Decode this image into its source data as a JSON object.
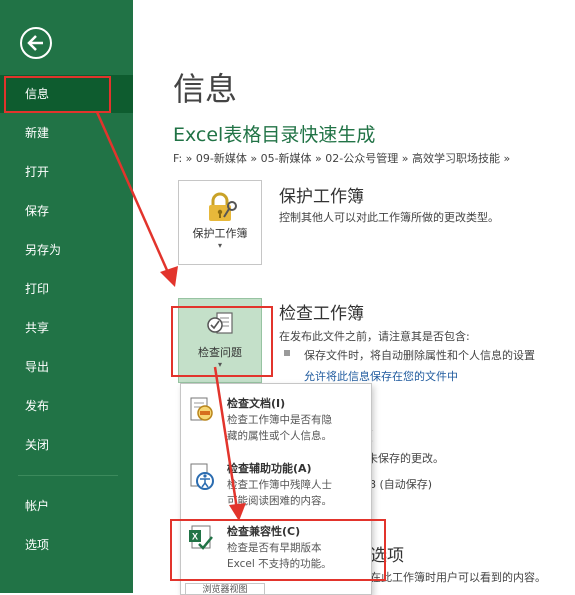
{
  "sidebar": {
    "items": [
      {
        "label": "信息"
      },
      {
        "label": "新建"
      },
      {
        "label": "打开"
      },
      {
        "label": "保存"
      },
      {
        "label": "另存为"
      },
      {
        "label": "打印"
      },
      {
        "label": "共享"
      },
      {
        "label": "导出"
      },
      {
        "label": "发布"
      },
      {
        "label": "关闭"
      },
      {
        "label": "帐户"
      },
      {
        "label": "选项"
      }
    ],
    "active_index": 0
  },
  "main": {
    "page_title": "信息",
    "workbook_title": "Excel表格目录快速生成",
    "breadcrumb": "F: » 09-新媒体 » 05-新媒体 » 02-公众号管理 » 高效学习职场技能 »",
    "protect": {
      "button_label": "保护工作簿",
      "title": "保护工作簿",
      "desc": "控制其他人可以对此工作簿所做的更改类型。"
    },
    "inspect": {
      "button_label": "检查问题",
      "title": "检查工作簿",
      "desc": "在发布此文件之前，请注意其是否包含:",
      "bullet": "保存文件时，将自动删除属性和个人信息的设置",
      "link": "允许将此信息保存在您的文件中"
    },
    "behind": {
      "title_fragment": "簿",
      "desc_fragment": "存未保存的更改。",
      "autosave_fragment": "8 (自动保存)",
      "options_fragment": "选项",
      "options_desc_fragment": "在此工作簿时用户可以看到的内容。",
      "view_button_fragment": "浏览器视图"
    }
  },
  "menu": {
    "items": [
      {
        "title": "检查文档(I)",
        "desc_line1": "检查工作簿中是否有隐",
        "desc_line2": "藏的属性或个人信息。",
        "icon": "inspect-document-icon"
      },
      {
        "title": "检查辅助功能(A)",
        "desc_line1": "检查工作簿中残障人士",
        "desc_line2": "可能阅读困难的内容。",
        "icon": "accessibility-icon"
      },
      {
        "title": "检查兼容性(C)",
        "desc_line1": "检查是否有早期版本",
        "desc_line2": "Excel 不支持的功能。",
        "icon": "compatibility-icon"
      }
    ]
  },
  "colors": {
    "sidebar": "#217346",
    "sidebar_active": "#0e5c2f",
    "annotation": "#e2342c",
    "link": "#1e5a9e"
  }
}
